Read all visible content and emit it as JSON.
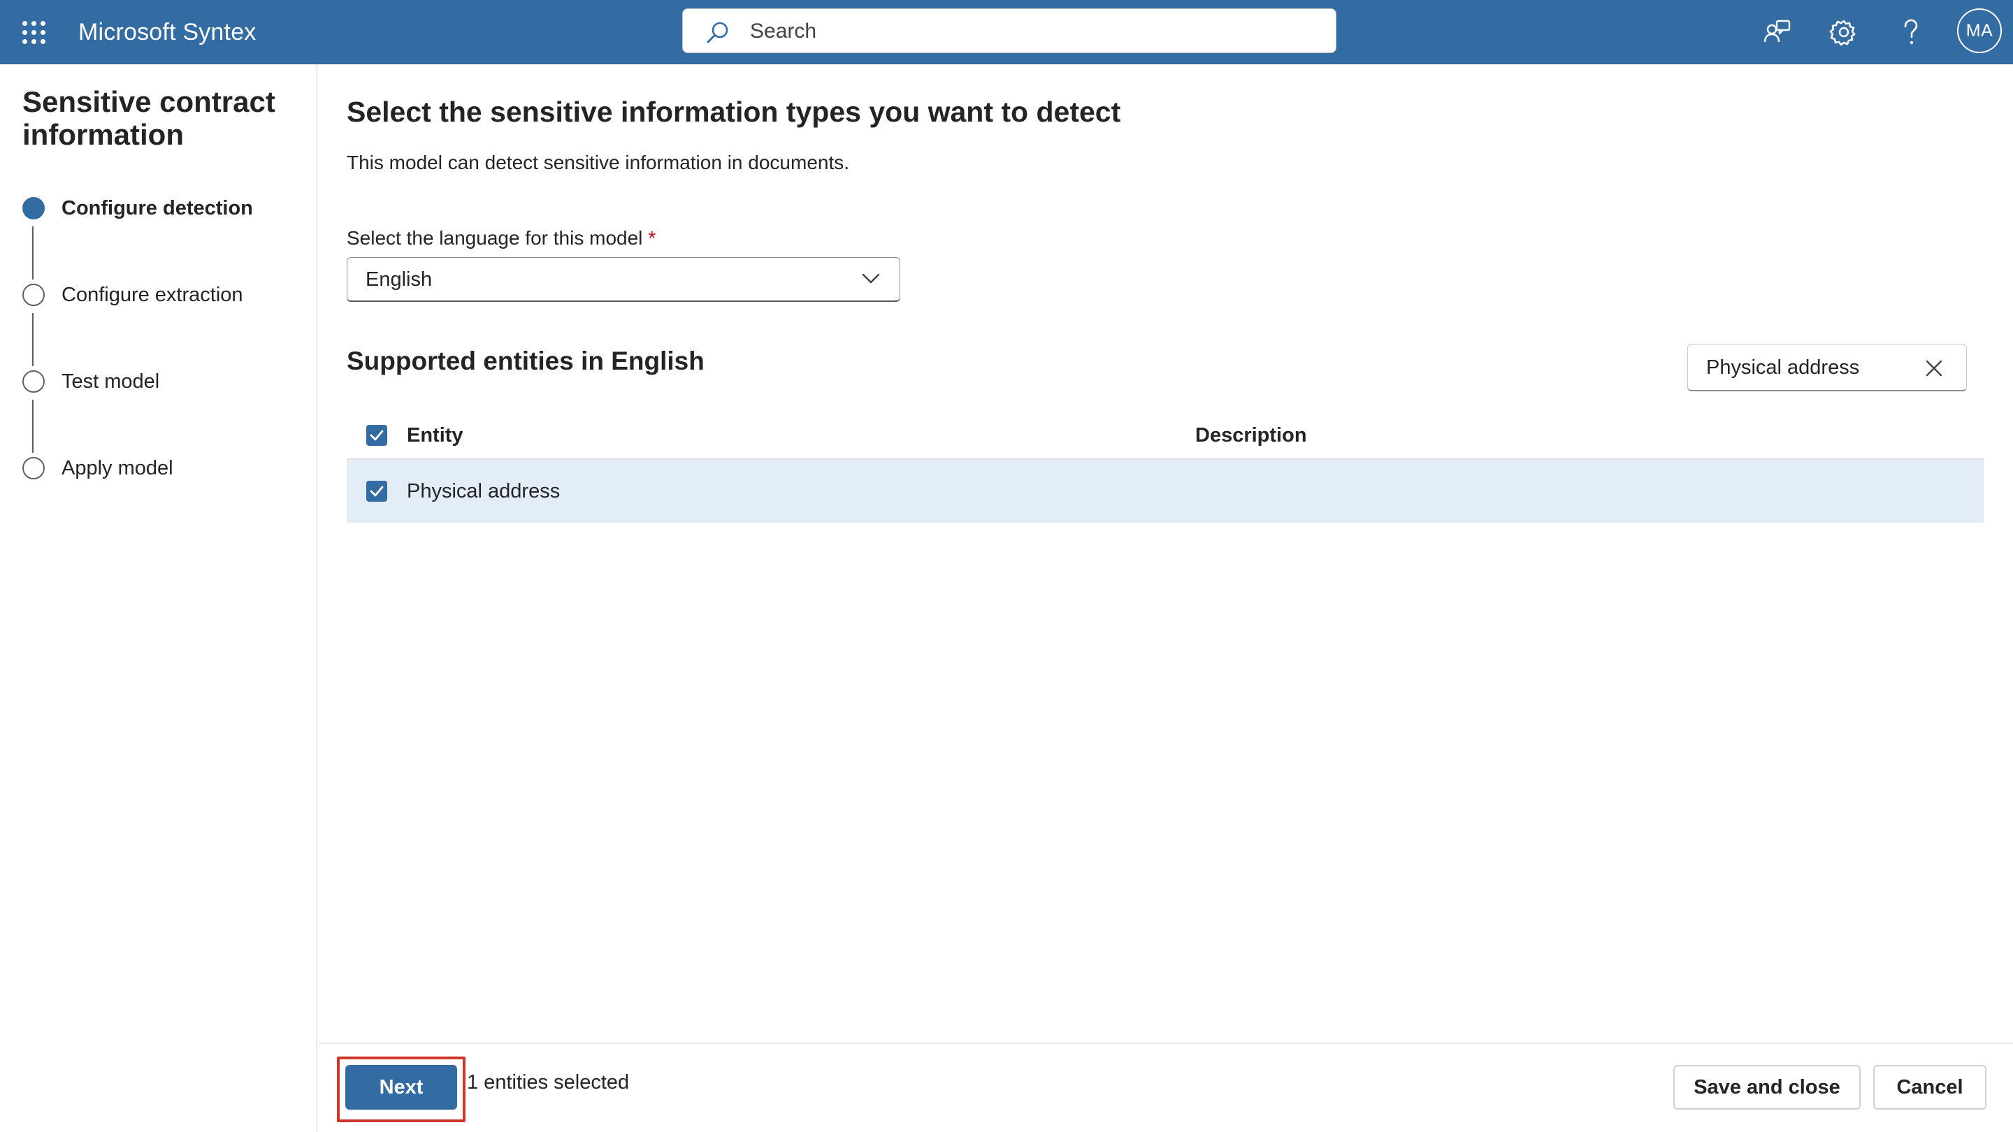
{
  "header": {
    "app_title": "Microsoft Syntex",
    "search_placeholder": "Search",
    "avatar_initials": "MA",
    "icons": [
      "app-launcher-icon",
      "search-icon",
      "feedback-icon",
      "gear-icon",
      "help-icon"
    ]
  },
  "wizard": {
    "model_title": "Sensitive contract information",
    "steps": [
      {
        "label": "Configure detection",
        "state": "current"
      },
      {
        "label": "Configure extraction",
        "state": "pending"
      },
      {
        "label": "Test model",
        "state": "pending"
      },
      {
        "label": "Apply model",
        "state": "pending"
      }
    ]
  },
  "main": {
    "heading": "Select the sensitive information types you want to detect",
    "description": "This model can detect sensitive information in documents.",
    "language_label": "Select the language for this model",
    "required_marker": "*",
    "language_value": "English",
    "entities_heading": "Supported entities in English",
    "filter_value": "Physical address",
    "table": {
      "columns": [
        "Entity",
        "Description"
      ],
      "rows": [
        {
          "entity": "Physical address",
          "description": "",
          "checked": true
        }
      ],
      "all_checked": true
    }
  },
  "footer": {
    "next_label": "Next",
    "selected_count_text": "1 entities selected",
    "save_close_label": "Save and close",
    "cancel_label": "Cancel"
  },
  "colors": {
    "brand": "#336ca3",
    "selected_row": "#e3edf8",
    "required": "#c50f1f",
    "highlight_outline": "#d0372a"
  }
}
